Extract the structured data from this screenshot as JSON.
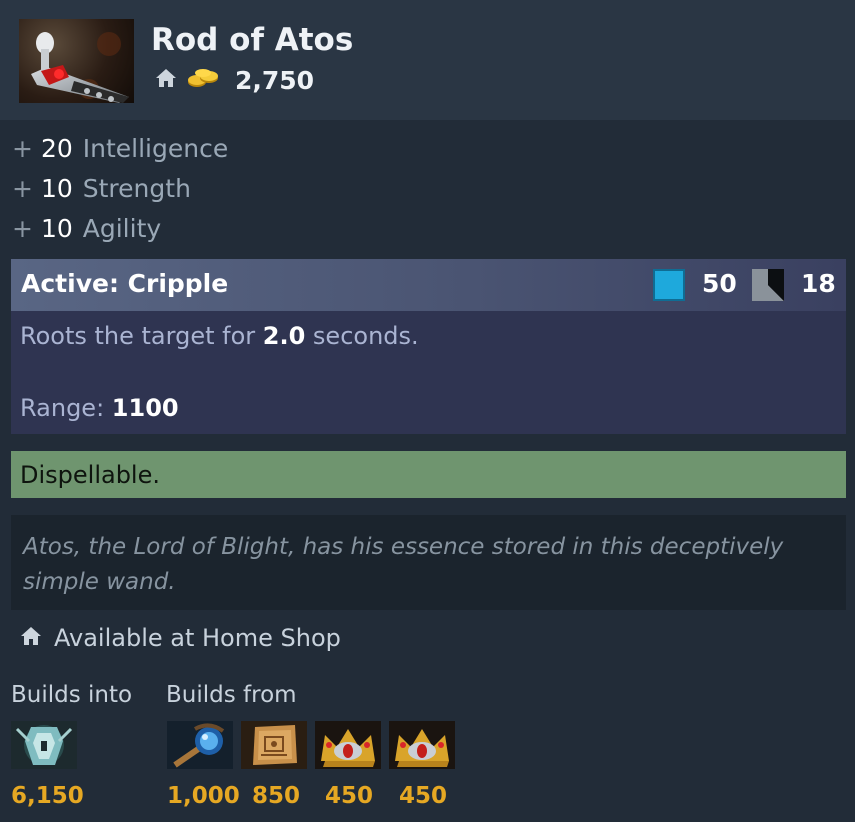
{
  "item": {
    "name": "Rod of Atos",
    "cost": "2,750",
    "icons": {
      "image": "rod-of-atos-image",
      "shop": "home-icon",
      "gold": "gold-coins-icon"
    }
  },
  "stats": [
    {
      "plus": "+",
      "value": "20",
      "label": "Intelligence"
    },
    {
      "plus": "+",
      "value": "10",
      "label": "Strength"
    },
    {
      "plus": "+",
      "value": "10",
      "label": "Agility"
    }
  ],
  "ability": {
    "title": "Active: Cripple",
    "mana_cost": "50",
    "cooldown": "18",
    "description_prefix": "Roots the target for",
    "description_value": "2.0",
    "description_suffix": "seconds.",
    "range_label": "Range:",
    "range_value": "1100",
    "colors": {
      "mana": "#1ea9dc",
      "header": "#596684"
    }
  },
  "dispellable": "Dispellable.",
  "lore": "Atos, the Lord of Blight, has his essence stored in this deceptively simple wand.",
  "shop": {
    "icon": "home-icon",
    "text": "Available at Home Shop"
  },
  "builds_into": {
    "label": "Builds into",
    "items": [
      {
        "icon": "gleipnir-item-icon",
        "price": "6,150"
      }
    ]
  },
  "builds_from": {
    "label": "Builds from",
    "items": [
      {
        "icon": "staff-of-wizardry-icon",
        "price": "1,000"
      },
      {
        "icon": "recipe-scroll-icon",
        "price": "850"
      },
      {
        "icon": "crown-icon",
        "price": "450"
      },
      {
        "icon": "crown-icon",
        "price": "450"
      }
    ]
  },
  "colors": {
    "gold_price": "#e6a823",
    "dispel_bg": "#6f956f",
    "panel_bg": "#222c38"
  }
}
